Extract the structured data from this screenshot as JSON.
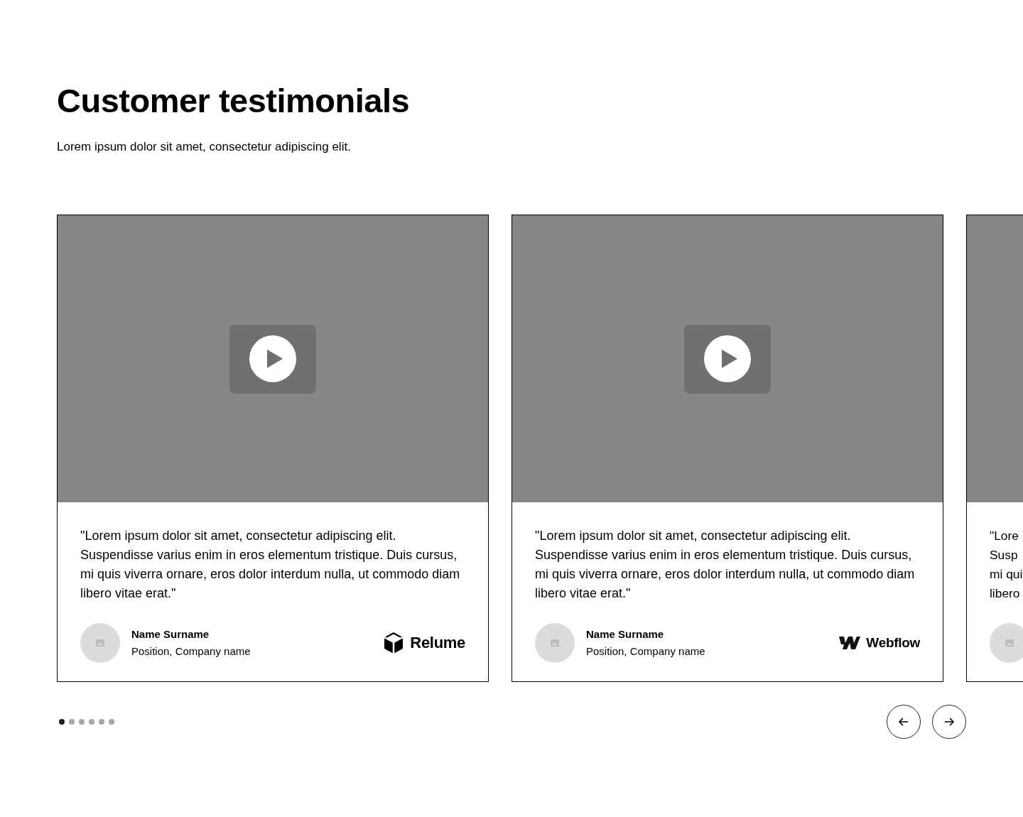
{
  "heading": "Customer testimonials",
  "subheading": "Lorem ipsum dolor sit amet, consectetur adipiscing elit.",
  "cards": [
    {
      "kind": "full",
      "quote": "\"Lorem ipsum dolor sit amet, consectetur adipiscing elit. Suspendisse varius enim in eros elementum tristique. Duis cursus, mi quis viverra ornare, eros dolor interdum nulla, ut commodo diam libero vitae erat.\"",
      "name": "Name Surname",
      "position": "Position, Company name",
      "logo": {
        "kind": "cube",
        "text": "Relume"
      }
    },
    {
      "kind": "full",
      "quote": "\"Lorem ipsum dolor sit amet, consectetur adipiscing elit. Suspendisse varius enim in eros elementum tristique. Duis cursus, mi quis viverra ornare, eros dolor interdum nulla, ut commodo diam libero vitae erat.\"",
      "name": "Name Surname",
      "position": "Position, Company name",
      "logo": {
        "kind": "w",
        "text": "Webflow"
      }
    },
    {
      "kind": "partial",
      "quote_lines": [
        "\"Lore",
        "Susp",
        "mi qui",
        "libero"
      ]
    }
  ],
  "dots": [
    {
      "selected": true
    },
    {
      "selected": false
    },
    {
      "selected": false
    },
    {
      "selected": false
    },
    {
      "selected": false
    },
    {
      "selected": false
    }
  ],
  "nav": [
    {
      "kind": "prev"
    },
    {
      "kind": "next"
    }
  ]
}
